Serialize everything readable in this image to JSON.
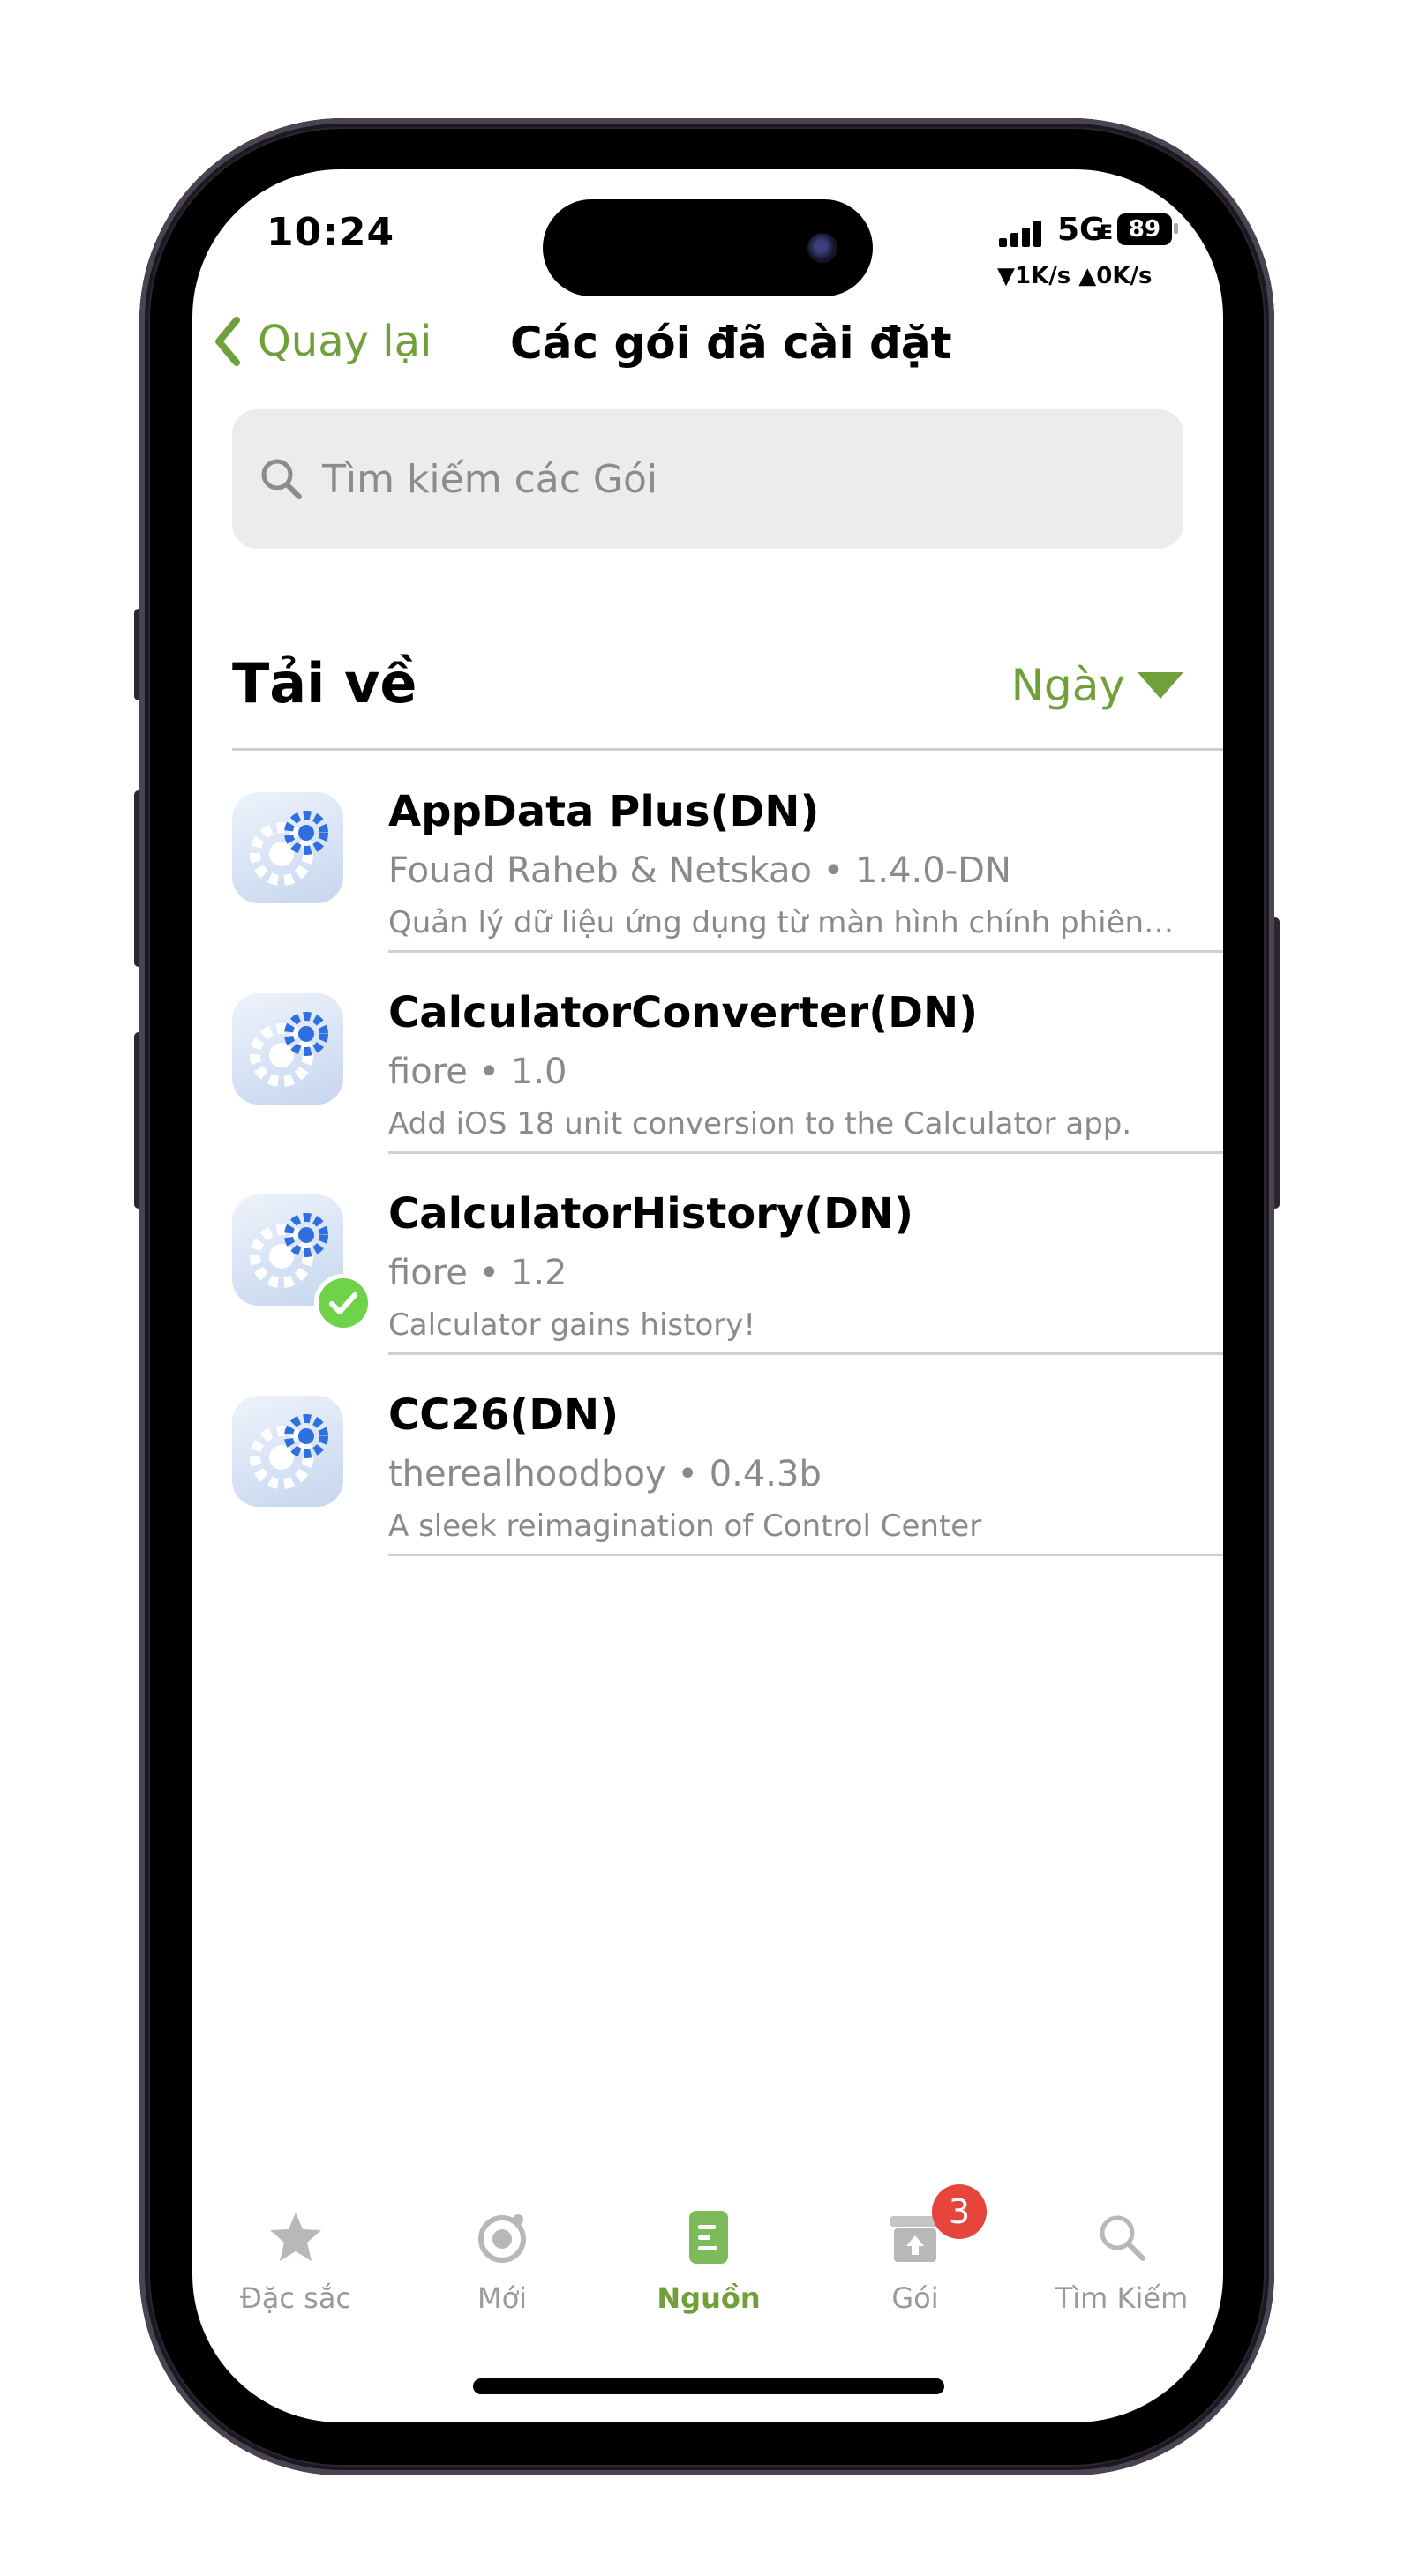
{
  "status_bar": {
    "time": "10:24",
    "network": "5G",
    "network_sub": "E",
    "battery": "89",
    "speed": "▼1K/s ▲0K/s"
  },
  "nav": {
    "back_label": "Quay lại",
    "title": "Các gói đã cài đặt"
  },
  "search": {
    "placeholder": "Tìm kiếm các Gói"
  },
  "section": {
    "title": "Tải về",
    "sort_label": "Ngày"
  },
  "packages": [
    {
      "name": "AppData Plus(DN)",
      "meta": "Fouad Raheb & Netskao • 1.4.0-DN",
      "description": "Quản lý dữ liệu ứng dụng từ màn hình chính phiên bản...",
      "installed_badge": false
    },
    {
      "name": "CalculatorConverter(DN)",
      "meta": "fiore • 1.0",
      "description": "Add iOS 18 unit conversion to the Calculator app.",
      "installed_badge": false
    },
    {
      "name": "CalculatorHistory(DN)",
      "meta": "fiore • 1.2",
      "description": "Calculator gains history!",
      "installed_badge": true
    },
    {
      "name": "CC26(DN)",
      "meta": "therealhoodboy • 0.4.3b",
      "description": "A sleek reimagination of Control Center",
      "installed_badge": false
    }
  ],
  "tabs": [
    {
      "label": "Đặc sắc",
      "icon": "star-icon"
    },
    {
      "label": "Mới",
      "icon": "new-icon"
    },
    {
      "label": "Nguồn",
      "icon": "sources-icon",
      "active": true
    },
    {
      "label": "Gói",
      "icon": "packages-icon",
      "badge": "3"
    },
    {
      "label": "Tìm Kiếm",
      "icon": "search-icon"
    }
  ],
  "colors": {
    "accent": "#6fa03a",
    "badge": "#e5453a",
    "installed": "#6fd34a"
  }
}
